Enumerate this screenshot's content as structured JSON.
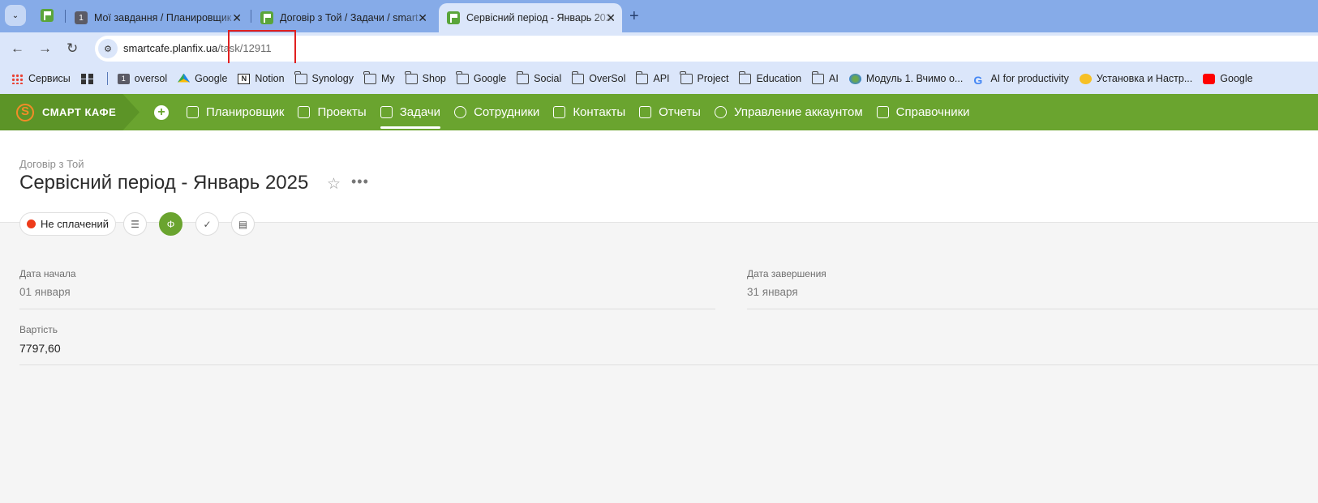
{
  "browser": {
    "tabs": [
      {
        "title": "Мої завдання / Планировщик",
        "favicon": "1",
        "active": false
      },
      {
        "title": "Договір з Той / Задачи / smart",
        "favicon": "flag",
        "active": false
      },
      {
        "title": "Сервісний період - Январь 2025",
        "favicon": "flag",
        "active": true
      }
    ],
    "new_tab": "+",
    "url_host": "smartcafe.planfix.ua",
    "url_path": "/task/12911"
  },
  "bookmarks": [
    {
      "label": "Сервисы",
      "icon": "apps-grid-icon"
    },
    {
      "label": "",
      "icon": "grid-icon"
    },
    {
      "label": "oversol",
      "icon": "num-icon"
    },
    {
      "label": "Google",
      "icon": "google-drive-icon"
    },
    {
      "label": "Notion",
      "icon": "notion-icon"
    },
    {
      "label": "Synology",
      "icon": "folder-icon"
    },
    {
      "label": "My",
      "icon": "folder-icon"
    },
    {
      "label": "Shop",
      "icon": "folder-icon"
    },
    {
      "label": "Google",
      "icon": "folder-icon"
    },
    {
      "label": "Social",
      "icon": "folder-icon"
    },
    {
      "label": "OverSol",
      "icon": "folder-icon"
    },
    {
      "label": "API",
      "icon": "folder-icon"
    },
    {
      "label": "Project",
      "icon": "folder-icon"
    },
    {
      "label": "Education",
      "icon": "folder-icon"
    },
    {
      "label": "AI",
      "icon": "folder-icon"
    },
    {
      "label": "Модуль 1. Вчимо о...",
      "icon": "globe-icon"
    },
    {
      "label": "AI for productivity",
      "icon": "google-icon"
    },
    {
      "label": "Установка и Настр...",
      "icon": "circle-icon"
    },
    {
      "label": "Google",
      "icon": "youtube-icon"
    }
  ],
  "app": {
    "logo": "СМАРТ КАФЕ",
    "nav": [
      {
        "label": "Планировщик",
        "active": false
      },
      {
        "label": "Проекты",
        "active": false
      },
      {
        "label": "Задачи",
        "active": true
      },
      {
        "label": "Сотрудники",
        "active": false
      },
      {
        "label": "Контакты",
        "active": false
      },
      {
        "label": "Отчеты",
        "active": false
      },
      {
        "label": "Управление аккаунтом",
        "active": false
      },
      {
        "label": "Справочники",
        "active": false
      }
    ]
  },
  "task": {
    "breadcrumb": "Договір з Той",
    "title": "Сервісний період - Январь 2025",
    "status": "Не сплачений",
    "status_color": "#ee3b1a",
    "fields": {
      "start_label": "Дата начала",
      "start_value": "01 января",
      "end_label": "Дата завершения",
      "end_value": "31 января",
      "cost_label": "Вартість",
      "cost_value": "7797,60"
    }
  },
  "colors": {
    "brand_green": "#6aa42f",
    "tab_strip": "#86abe8",
    "highlight": "#e02020"
  }
}
